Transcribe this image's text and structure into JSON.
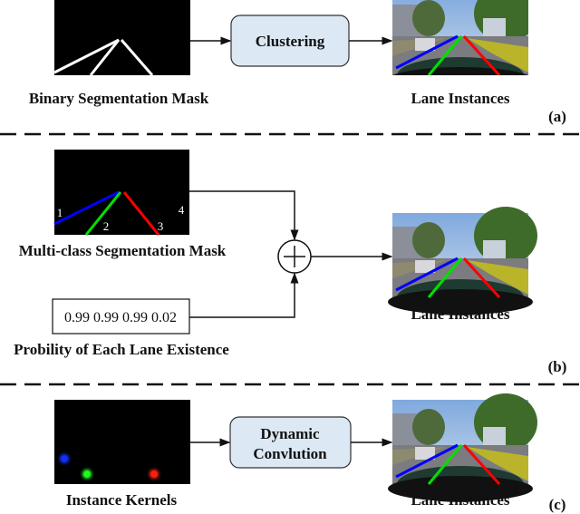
{
  "panel_a": {
    "input_label": "Binary Segmentation Mask",
    "process_label": "Clustering",
    "output_label": "Lane Instances",
    "tag": "(a)"
  },
  "panel_b": {
    "input_label": "Multi-class Segmentation Mask",
    "lane_numbers": [
      "1",
      "2",
      "3",
      "4"
    ],
    "probabilities": "0.99 0.99 0.99 0.02",
    "prob_label": "Probility of Each Lane Existence",
    "output_label": "Lane Instances",
    "tag": "(b)"
  },
  "panel_c": {
    "input_label": "Instance Kernels",
    "process_line1": "Dynamic",
    "process_line2": "Convlution",
    "output_label": "Lane Instances",
    "tag": "(c)"
  },
  "colors": {
    "box_fill": "#dce8f4",
    "lane_1": "#0000ff",
    "lane_2": "#00e000",
    "lane_3": "#ff0000"
  }
}
